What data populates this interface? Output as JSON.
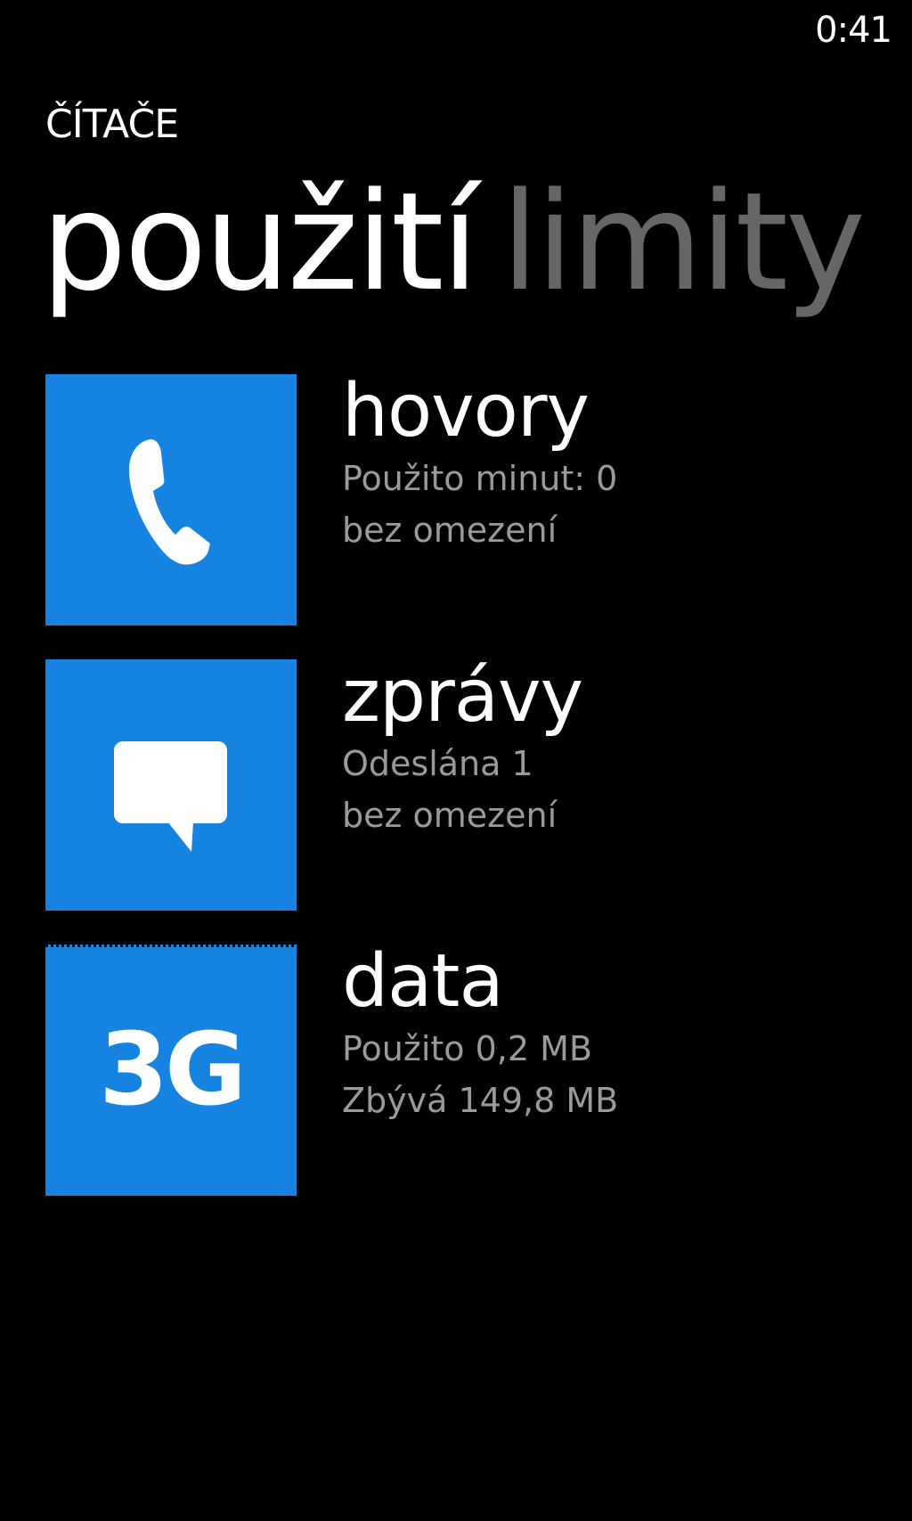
{
  "status_bar": {
    "time": "0:41"
  },
  "app": {
    "title": "ČÍTAČE"
  },
  "pivot": {
    "active": "použití",
    "inactive": "limity"
  },
  "colors": {
    "accent": "#1683e0",
    "background": "#000000",
    "secondary_text": "#9a9a9a",
    "inactive_pivot": "#666666"
  },
  "items": [
    {
      "icon": "phone-icon",
      "title": "hovory",
      "line1": "Použito minut: 0",
      "line2": "bez omezení"
    },
    {
      "icon": "message-icon",
      "title": "zprávy",
      "line1": "Odeslána 1",
      "line2": "bez omezení"
    },
    {
      "icon": "3g-icon",
      "icon_text": "3G",
      "title": "data",
      "line1": "Použito 0,2 MB",
      "line2": "Zbývá 149,8 MB"
    }
  ]
}
